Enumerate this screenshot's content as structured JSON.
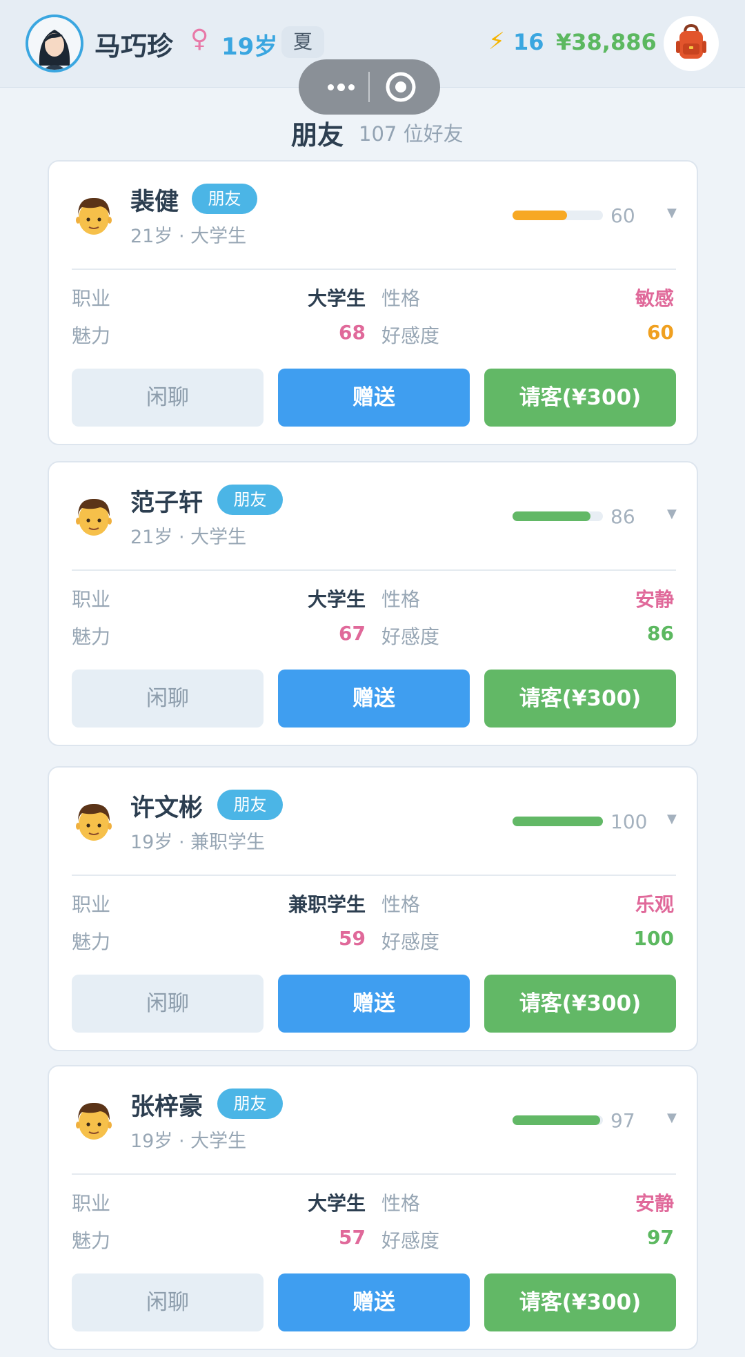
{
  "header": {
    "player_name": "马巧珍",
    "gender_symbol": "♀",
    "age": "19岁",
    "season": "夏",
    "energy_symbol": "⚡",
    "energy": "16",
    "money": "¥38,886"
  },
  "page": {
    "title": "朋友",
    "count": "107 位好友"
  },
  "labels": {
    "occupation": "职业",
    "personality": "性格",
    "charm": "魅力",
    "affection": "好感度",
    "chat_button": "闲聊",
    "gift_button": "赠送",
    "treat_button": "请客(¥300)"
  },
  "friends": [
    {
      "name": "裴健",
      "tag": "朋友",
      "subtitle": "21岁 · 大学生",
      "affection_value": "60",
      "occupation": "大学生",
      "personality": "敏感",
      "charm": "68",
      "affection": "60",
      "bar_fraction": 0.6,
      "bar_color": "#f7a823",
      "affection_color": "#f0a020"
    },
    {
      "name": "范子轩",
      "tag": "朋友",
      "subtitle": "21岁 · 大学生",
      "affection_value": "86",
      "occupation": "大学生",
      "personality": "安静",
      "charm": "67",
      "affection": "86",
      "bar_fraction": 0.86,
      "bar_color": "#62b866",
      "affection_color": "#5cb860"
    },
    {
      "name": "许文彬",
      "tag": "朋友",
      "subtitle": "19岁 · 兼职学生",
      "affection_value": "100",
      "occupation": "兼职学生",
      "personality": "乐观",
      "charm": "59",
      "affection": "100",
      "bar_fraction": 1.0,
      "bar_color": "#62b866",
      "affection_color": "#5cb860"
    },
    {
      "name": "张梓豪",
      "tag": "朋友",
      "subtitle": "19岁 · 大学生",
      "affection_value": "97",
      "occupation": "大学生",
      "personality": "安静",
      "charm": "57",
      "affection": "97",
      "bar_fraction": 0.97,
      "bar_color": "#62b866",
      "affection_color": "#5cb860"
    }
  ],
  "colors": {
    "accent_blue": "#3aa6e0",
    "pink": "#e0699a",
    "green": "#62b866",
    "orange": "#f7a823"
  }
}
